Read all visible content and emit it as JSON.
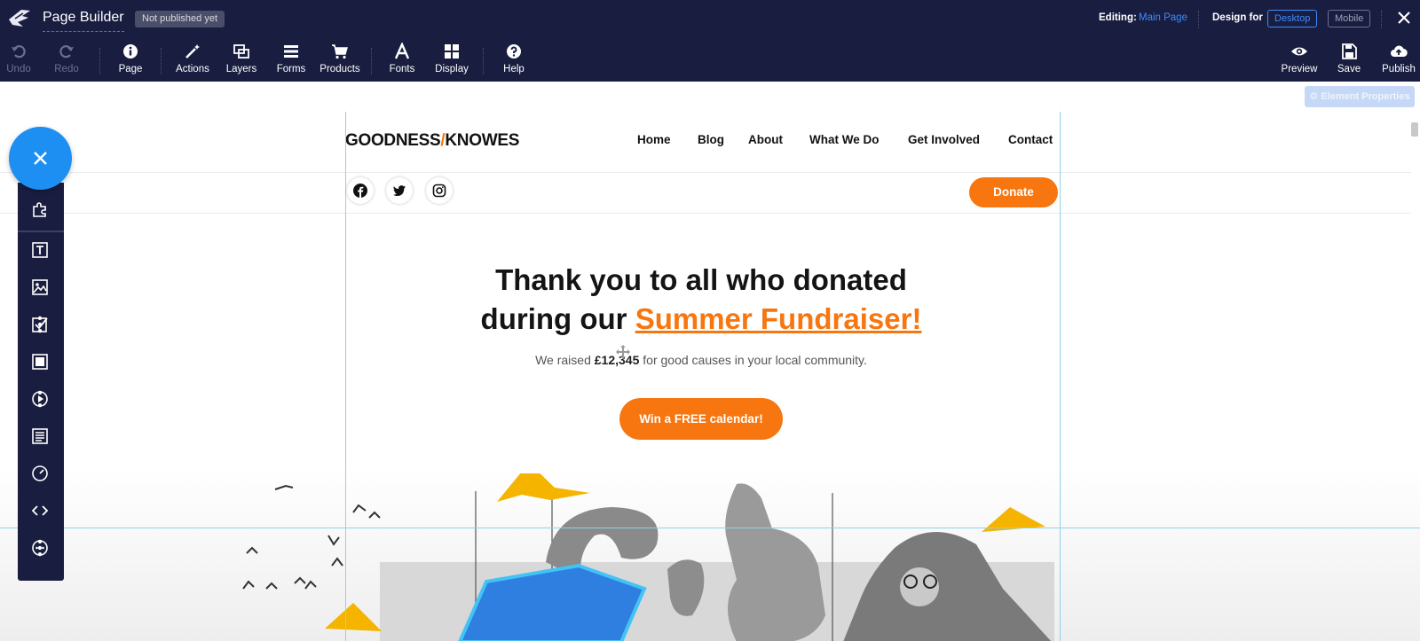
{
  "app": {
    "title": "Page Builder",
    "publish_status": "Not published yet"
  },
  "toolbar": {
    "left_tools": [
      {
        "id": "undo",
        "label": "Undo",
        "icon": "undo-icon",
        "disabled": true
      },
      {
        "id": "redo",
        "label": "Redo",
        "icon": "redo-icon",
        "disabled": true
      },
      {
        "id": "page",
        "label": "Page",
        "icon": "info-icon"
      },
      {
        "id": "actions",
        "label": "Actions",
        "icon": "magic-wand-icon"
      },
      {
        "id": "layers",
        "label": "Layers",
        "icon": "layers-icon"
      },
      {
        "id": "forms",
        "label": "Forms",
        "icon": "forms-icon"
      },
      {
        "id": "products",
        "label": "Products",
        "icon": "cart-icon"
      },
      {
        "id": "fonts",
        "label": "Fonts",
        "icon": "font-icon"
      },
      {
        "id": "display",
        "label": "Display",
        "icon": "grid-icon"
      },
      {
        "id": "help",
        "label": "Help",
        "icon": "question-icon"
      }
    ],
    "editing_label": "Editing:",
    "editing_value": "Main Page",
    "design_for_label": "Design for",
    "device_desktop": "Desktop",
    "device_mobile": "Mobile",
    "right_tools": [
      {
        "id": "preview",
        "label": "Preview",
        "icon": "eye-icon"
      },
      {
        "id": "save",
        "label": "Save",
        "icon": "save-icon"
      },
      {
        "id": "publish",
        "label": "Publish",
        "icon": "cloud-upload-icon"
      }
    ]
  },
  "subbar": {
    "element_properties": "⚙ Element Properties"
  },
  "site": {
    "brand_left": "GOODNESS",
    "brand_slash": "/",
    "brand_right": "KNOWES",
    "nav": [
      "Home",
      "Blog",
      "About",
      "What We Do",
      "Get Involved",
      "Contact"
    ],
    "social_icons": [
      "facebook-icon",
      "twitter-icon",
      "instagram-icon"
    ],
    "donate_label": "Donate",
    "headline_1": "Thank you to all who donated",
    "headline_2a": "during our ",
    "headline_2b": "Summer Fundraiser!",
    "sub_a": "We raised ",
    "sub_amount": "£12,345",
    "sub_b": " for good causes in your local community.",
    "cta_label": "Win a FREE calendar!"
  },
  "palette": {
    "items": [
      "puzzle-icon",
      "text-icon",
      "image-icon",
      "checkbox-icon",
      "block-icon",
      "video-icon",
      "paragraph-icon",
      "timer-icon",
      "code-icon",
      "more-icon"
    ]
  },
  "colors": {
    "toolbar_bg": "#191d40",
    "accent_blue": "#3d8cff",
    "brand_orange": "#f7760f",
    "fab_blue": "#1d8ff2",
    "guide_cyan": "#8fd3e6"
  }
}
